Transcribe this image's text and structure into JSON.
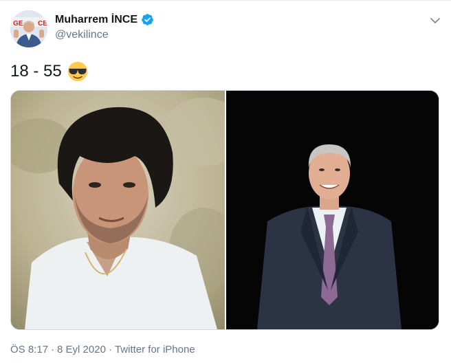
{
  "author": {
    "display_name": "Muharrem İNCE",
    "handle": "@vekilince",
    "verified": true,
    "verified_color": "#1da1f2"
  },
  "tweet": {
    "text": "18 - 55",
    "emoji": "smiling-face-with-sunglasses"
  },
  "media": {
    "photos": [
      {
        "name": "young-portrait-photo"
      },
      {
        "name": "current-portrait-photo"
      }
    ]
  },
  "meta": {
    "time": "ÖS 8:17",
    "separator1": "·",
    "date": "8 Eyl 2020",
    "separator2": "·",
    "source": "Twitter for iPhone"
  },
  "colors": {
    "text": "#14171a",
    "secondary_text": "#657786",
    "border": "#e6ecf0"
  }
}
